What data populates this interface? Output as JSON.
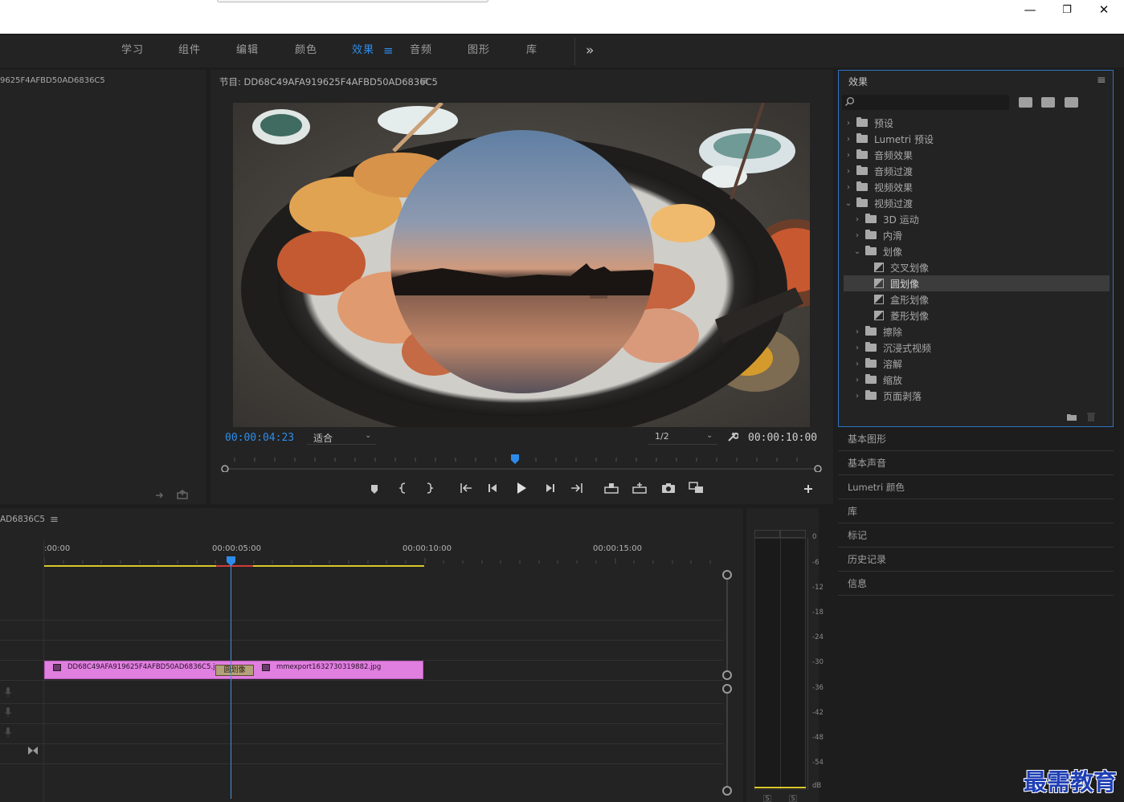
{
  "window": {
    "minimize_glyph": "—",
    "restore_glyph": "❐",
    "close_glyph": "✕"
  },
  "workspace": {
    "tabs": [
      "学习",
      "组件",
      "编辑",
      "颜色",
      "效果",
      "音频",
      "图形",
      "库"
    ],
    "active": "效果",
    "active_menu_glyph": "≡",
    "overflow_glyph": "»"
  },
  "source_panel": {
    "title": "9625F4AFBD50AD6836C5"
  },
  "program": {
    "title": "节目: DD68C49AFA919625F4AFBD50AD6836C5",
    "menu_glyph": "≡",
    "timecode_current": "00:00:04:23",
    "zoom": "适合",
    "resolution": "1/2",
    "timecode_duration": "00:00:10:00"
  },
  "timeline": {
    "title": "AD6836C5",
    "menu_glyph": "≡",
    "ruler_labels": [
      ":00:00",
      "00:00:05:00",
      "00:00:10:00",
      "00:00:15:00"
    ],
    "clip_a": "DD68C49AFA919625F4AFBD50AD6836C5.jp",
    "transition": "圆划像",
    "clip_b": "mmexport1632730319882.jpg"
  },
  "meters": {
    "scale": [
      "0",
      "-6",
      "-12",
      "-18",
      "-24",
      "-30",
      "-36",
      "-42",
      "-48",
      "-54",
      "dB"
    ],
    "solo_labels": [
      "S",
      "S"
    ]
  },
  "effects": {
    "title": "效果",
    "menu_glyph": "≡",
    "search_placeholder": "",
    "tree": [
      {
        "label": "预设",
        "depth": 0,
        "state": "closed",
        "kind": "folder-preset"
      },
      {
        "label": "Lumetri 预设",
        "depth": 0,
        "state": "closed",
        "kind": "folder-preset"
      },
      {
        "label": "音频效果",
        "depth": 0,
        "state": "closed",
        "kind": "folder"
      },
      {
        "label": "音频过渡",
        "depth": 0,
        "state": "closed",
        "kind": "folder"
      },
      {
        "label": "视频效果",
        "depth": 0,
        "state": "closed",
        "kind": "folder"
      },
      {
        "label": "视频过渡",
        "depth": 0,
        "state": "open",
        "kind": "folder"
      },
      {
        "label": "3D 运动",
        "depth": 1,
        "state": "closed",
        "kind": "folder"
      },
      {
        "label": "内滑",
        "depth": 1,
        "state": "closed",
        "kind": "folder"
      },
      {
        "label": "划像",
        "depth": 1,
        "state": "open",
        "kind": "folder"
      },
      {
        "label": "交叉划像",
        "depth": 2,
        "state": "leaf",
        "kind": "fx"
      },
      {
        "label": "圆划像",
        "depth": 2,
        "state": "leaf",
        "kind": "fx",
        "selected": true
      },
      {
        "label": "盒形划像",
        "depth": 2,
        "state": "leaf",
        "kind": "fx"
      },
      {
        "label": "菱形划像",
        "depth": 2,
        "state": "leaf",
        "kind": "fx"
      },
      {
        "label": "擦除",
        "depth": 1,
        "state": "closed",
        "kind": "folder"
      },
      {
        "label": "沉浸式视频",
        "depth": 1,
        "state": "closed",
        "kind": "folder"
      },
      {
        "label": "溶解",
        "depth": 1,
        "state": "closed",
        "kind": "folder"
      },
      {
        "label": "缩放",
        "depth": 1,
        "state": "closed",
        "kind": "folder"
      },
      {
        "label": "页面剥落",
        "depth": 1,
        "state": "closed",
        "kind": "folder"
      }
    ]
  },
  "side_panels": [
    "基本图形",
    "基本声音",
    "Lumetri 颜色",
    "库",
    "标记",
    "历史记录",
    "信息"
  ],
  "watermark": "最需教育",
  "colors": {
    "accent": "#2d8ceb",
    "clip": "#e07fe0",
    "work_area": "#d9c82a",
    "panel_focus": "#2f74c2"
  }
}
